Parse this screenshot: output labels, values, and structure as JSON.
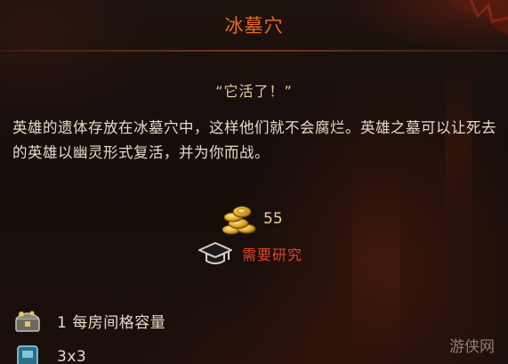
{
  "tooltip": {
    "title": "冰墓穴",
    "quote": "“它活了！”",
    "description": "英雄的遗体存放在冰墓穴中，这样他们就不会腐烂。英雄之墓可以让死去的英雄以幽灵形式复活，并为你而战。",
    "cost": {
      "icon": "gold-coins-icon",
      "value": "55"
    },
    "requirement": {
      "icon": "graduation-cap-icon",
      "label": "需要研究"
    },
    "stats": [
      {
        "icon": "treasure-chest-icon",
        "text": "1 每房间格容量"
      },
      {
        "icon": "room-size-icon",
        "text": "3x3"
      }
    ],
    "watermark": "游侠网"
  },
  "colors": {
    "title": "#e8692a",
    "requirement": "#e0442f",
    "body_text": "#e6dcc9",
    "background": "#1a0f0b"
  }
}
